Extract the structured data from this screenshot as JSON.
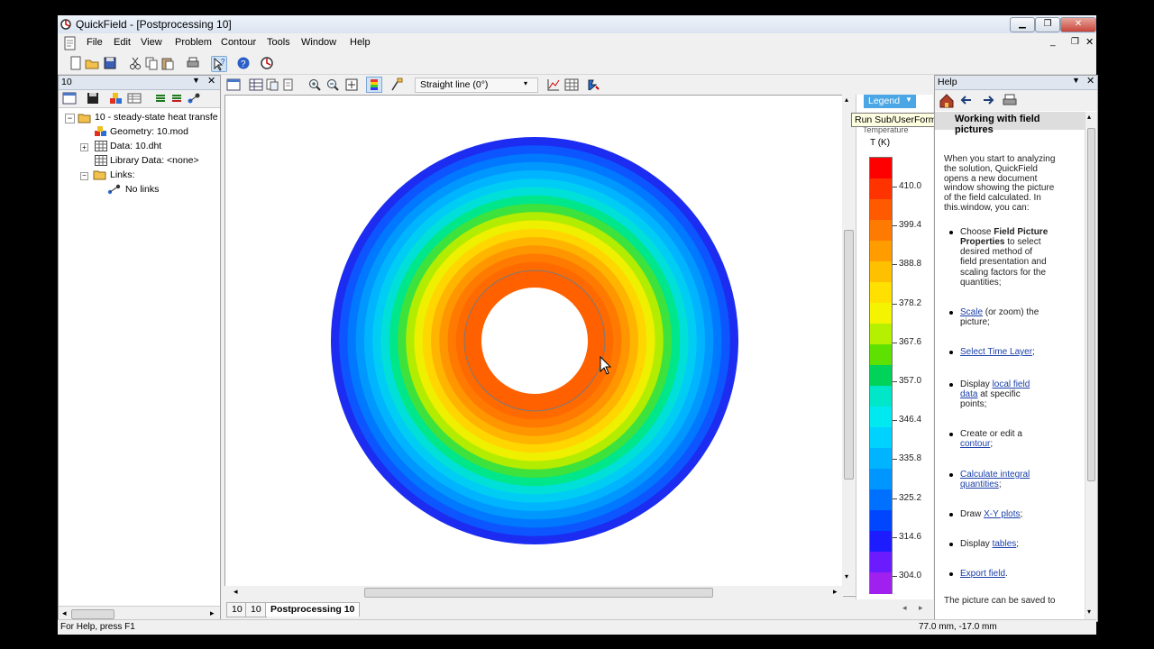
{
  "window": {
    "title": "QuickField - [Postprocessing 10]",
    "controls": [
      "minimize",
      "maximize",
      "close"
    ]
  },
  "menu": [
    "File",
    "Edit",
    "View",
    "Problem",
    "Contour",
    "Tools",
    "Window",
    "Help"
  ],
  "left_panel": {
    "title": "10",
    "tree": [
      {
        "label": "10 - steady-state heat transfe",
        "level": 0,
        "icon": "folder-open-icon"
      },
      {
        "label": "Geometry: 10.mod",
        "level": 1,
        "icon": "geometry-icon"
      },
      {
        "label": "Data: 10.dht",
        "level": 1,
        "icon": "data-table-icon"
      },
      {
        "label": "Library Data: <none>",
        "level": 1,
        "icon": "data-table-icon"
      },
      {
        "label": "Links:",
        "level": 1,
        "icon": "folder-icon"
      },
      {
        "label": "No links",
        "level": 2,
        "icon": "link-icon"
      }
    ]
  },
  "center_toolbar": {
    "contour_mode": "Straight line (0°)"
  },
  "legend": {
    "tab_label": "Legend",
    "quantity": "Temperature",
    "unit": "T (K)",
    "values": [
      "410.0",
      "399.4",
      "388.8",
      "378.2",
      "367.6",
      "357.0",
      "346.4",
      "335.8",
      "325.2",
      "314.6",
      "304.0"
    ],
    "colors": [
      "#ff0000",
      "#ff3300",
      "#ff5a00",
      "#ff7a00",
      "#ff9d00",
      "#ffc000",
      "#ffe000",
      "#f4f400",
      "#b4f000",
      "#5ee000",
      "#00d25a",
      "#00e6c8",
      "#00e8f0",
      "#00d2ff",
      "#00b4ff",
      "#0096ff",
      "#0070ff",
      "#0046ff",
      "#1c1cff",
      "#6a1cff",
      "#a020f0"
    ]
  },
  "tooltip": "Run Sub/UserForm (F5)",
  "doc_tabs": [
    "10",
    "10",
    "Postprocessing 10"
  ],
  "active_tab": "Postprocessing 10",
  "help": {
    "title": "Help",
    "heading": "Working with field pictures",
    "intro": [
      "When you start to analyzing",
      "the solution, QuickField",
      "opens a new document",
      "window showing the picture",
      "of the field calculated. In",
      "this.window, you can:"
    ],
    "bullets": [
      {
        "lines": [
          {
            "t": "Choose ",
            "b": false,
            "l": false
          },
          {
            "t": "Field Picture",
            "b": true,
            "l": false
          }
        ],
        "rest": [
          [
            {
              "t": "Properties",
              "b": true
            },
            {
              "t": " to select"
            }
          ],
          [
            {
              "t": "desired method of"
            }
          ],
          [
            {
              "t": "field presentation and"
            }
          ],
          [
            {
              "t": "scaling factors for the"
            }
          ],
          [
            {
              "t": "quantities;"
            }
          ]
        ]
      },
      {
        "lines": [
          {
            "t": "Scale",
            "l": true
          },
          {
            "t": " (or zoom) the"
          }
        ],
        "rest": [
          [
            {
              "t": "picture;"
            }
          ]
        ]
      },
      {
        "lines": [
          {
            "t": "Select Time Layer",
            "l": true
          },
          {
            "t": ";"
          }
        ],
        "rest": []
      },
      {
        "lines": [
          {
            "t": "Display "
          },
          {
            "t": "local field",
            "l": true
          }
        ],
        "rest": [
          [
            {
              "t": "data",
              "l": true
            },
            {
              "t": " at specific"
            }
          ],
          [
            {
              "t": "points;"
            }
          ]
        ]
      },
      {
        "lines": [
          {
            "t": "Create or edit a"
          }
        ],
        "rest": [
          [
            {
              "t": "contour",
              "l": true
            },
            {
              "t": ";"
            }
          ]
        ]
      },
      {
        "lines": [
          {
            "t": "Calculate integral",
            "l": true
          }
        ],
        "rest": [
          [
            {
              "t": "quantities",
              "l": true
            },
            {
              "t": ";"
            }
          ]
        ]
      },
      {
        "lines": [
          {
            "t": "Draw "
          },
          {
            "t": "X-Y plots",
            "l": true
          },
          {
            "t": ";"
          }
        ],
        "rest": []
      },
      {
        "lines": [
          {
            "t": "Display "
          },
          {
            "t": "tables",
            "l": true
          },
          {
            "t": ";"
          }
        ],
        "rest": []
      },
      {
        "lines": [
          {
            "t": "Export field",
            "l": true
          },
          {
            "t": "."
          }
        ],
        "rest": []
      }
    ],
    "tail": "The picture can be saved to"
  },
  "status": {
    "left": "For Help, press F1",
    "coords": "77.0 mm, -17.0 mm"
  },
  "field_plot": {
    "rings": [
      "#1c2cf0",
      "#0d56ff",
      "#0078ff",
      "#0098ff",
      "#00b4ff",
      "#00cdf4",
      "#00e0d8",
      "#00e68a",
      "#3ee23c",
      "#b2ec00",
      "#eef000",
      "#ffd600",
      "#ffb400",
      "#ff9600",
      "#ff7a00",
      "#ff6a00",
      "#ff6000"
    ]
  }
}
